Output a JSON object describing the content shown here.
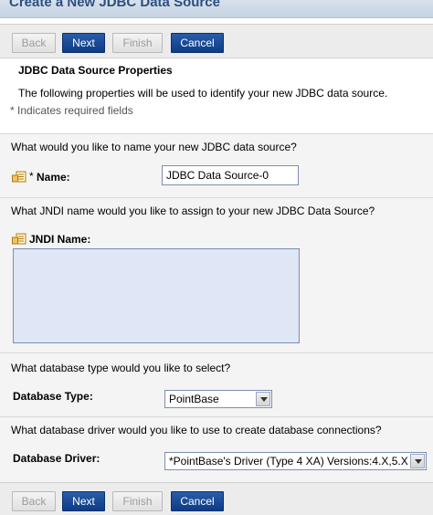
{
  "title": "Create a New JDBC Data Source",
  "buttons": {
    "back": "Back",
    "next": "Next",
    "finish": "Finish",
    "cancel": "Cancel"
  },
  "section": {
    "title": "JDBC Data Source Properties",
    "description": "The following properties will be used to identify your new JDBC data source.",
    "required_note": "* Indicates required fields"
  },
  "name": {
    "question": "What would you like to name your new JDBC data source?",
    "required_marker": "*",
    "label": "Name:",
    "value": "JDBC Data Source-0"
  },
  "jndi": {
    "question": "What JNDI name would you like to assign to your new JDBC Data Source?",
    "label": "JNDI Name:",
    "value": ""
  },
  "db_type": {
    "question": "What database type would you like to select?",
    "label": "Database Type:",
    "selected": "PointBase"
  },
  "db_driver": {
    "question": "What database driver would you like to use to create database connections?",
    "label": "Database Driver:",
    "selected": "*PointBase's Driver (Type 4 XA) Versions:4.X,5.X"
  },
  "colors": {
    "primary_button": "#0e3c86",
    "title_text": "#2d4f7f",
    "jndi_area": "#dfe6f6"
  }
}
